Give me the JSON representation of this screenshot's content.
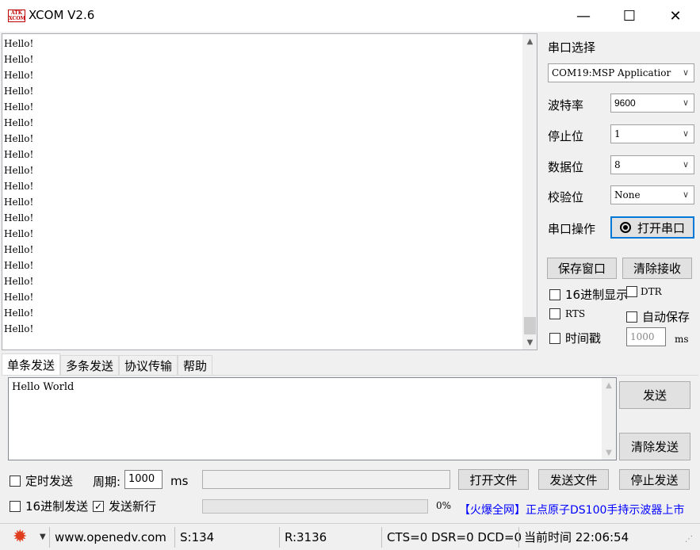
{
  "window": {
    "logo_text": "ATK\nXCOM",
    "title": "XCOM V2.6",
    "minimize_glyph": "—",
    "maximize_glyph": "☐",
    "close_glyph": "✕"
  },
  "receive": {
    "lines": [
      "Hello!",
      "Hello!",
      "Hello!",
      "Hello!",
      "Hello!",
      "Hello!",
      "Hello!",
      "Hello!",
      "Hello!",
      "Hello!",
      "Hello!",
      "Hello!",
      "Hello!",
      "Hello!",
      "Hello!",
      "Hello!",
      "Hello!",
      "Hello!",
      "Hello!"
    ],
    "scroll_up_icon": "up-arrow-icon",
    "scroll_down_icon": "down-arrow-icon"
  },
  "serial": {
    "port_label": "串口选择",
    "port_value": "COM19:MSP Applicatior",
    "baud_label": "波特率",
    "baud_value": "9600",
    "stop_label": "停止位",
    "stop_value": "1",
    "data_label": "数据位",
    "data_value": "8",
    "parity_label": "校验位",
    "parity_value": "None",
    "op_label": "串口操作",
    "open_port_button": "打开串口"
  },
  "options": {
    "save_window": "保存窗口",
    "clear_receive": "清除接收",
    "hex_display": "16进制显示",
    "dtr": "DTR",
    "rts": "RTS",
    "auto_save": "自动保存",
    "timestamp": "时间戳",
    "timestamp_value": "1000",
    "timestamp_unit": "ms"
  },
  "tabs": [
    "单条发送",
    "多条发送",
    "协议传输",
    "帮助"
  ],
  "send": {
    "text": "Hello World",
    "send_button": "发送",
    "clear_send_button": "清除发送"
  },
  "bottom": {
    "timed_send": "定时发送",
    "period_label": "周期:",
    "period_value": "1000",
    "period_unit": "ms",
    "open_file": "打开文件",
    "send_file": "发送文件",
    "stop_send": "停止发送",
    "hex_send": "16进制发送",
    "send_newline": "发送新行",
    "progress_text": "0%",
    "progress_value": 0,
    "promo": "【火爆全网】正点原子DS100手持示波器上市"
  },
  "status": {
    "settings_icon": "gear-icon",
    "url": "www.openedv.com",
    "sent": "S:134",
    "received": "R:3136",
    "lines": "CTS=0 DSR=0 DCD=0",
    "time": "当前时间 22:06:54"
  },
  "colors": {
    "accent": "#0078d7",
    "logo_red": "#c00000",
    "promo_blue": "#0000ff",
    "gear_red": "#e03c1e"
  }
}
